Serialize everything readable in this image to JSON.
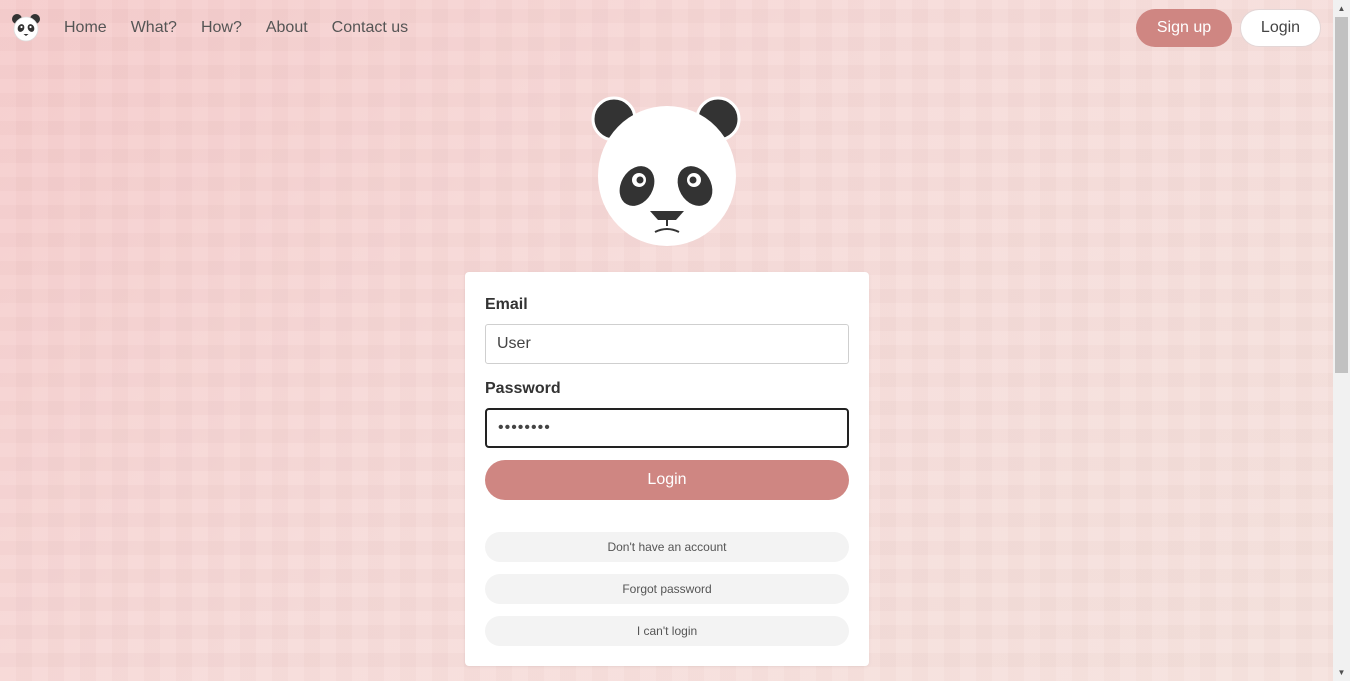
{
  "nav": {
    "links": [
      "Home",
      "What?",
      "How?",
      "About",
      "Contact us"
    ],
    "signup_label": "Sign up",
    "login_label": "Login"
  },
  "form": {
    "email_label": "Email",
    "email_value": "User",
    "password_label": "Password",
    "password_value": "••••••••",
    "login_label": "Login",
    "no_account_label": "Don't have an account",
    "forgot_label": "Forgot password",
    "cant_login_label": "I can't login"
  },
  "colors": {
    "accent": "#cf8682",
    "card": "#ffffff",
    "link_bg": "#f3f3f3"
  },
  "icons": {
    "nav_logo": "panda-logo-icon",
    "hero": "panda-face-icon"
  }
}
